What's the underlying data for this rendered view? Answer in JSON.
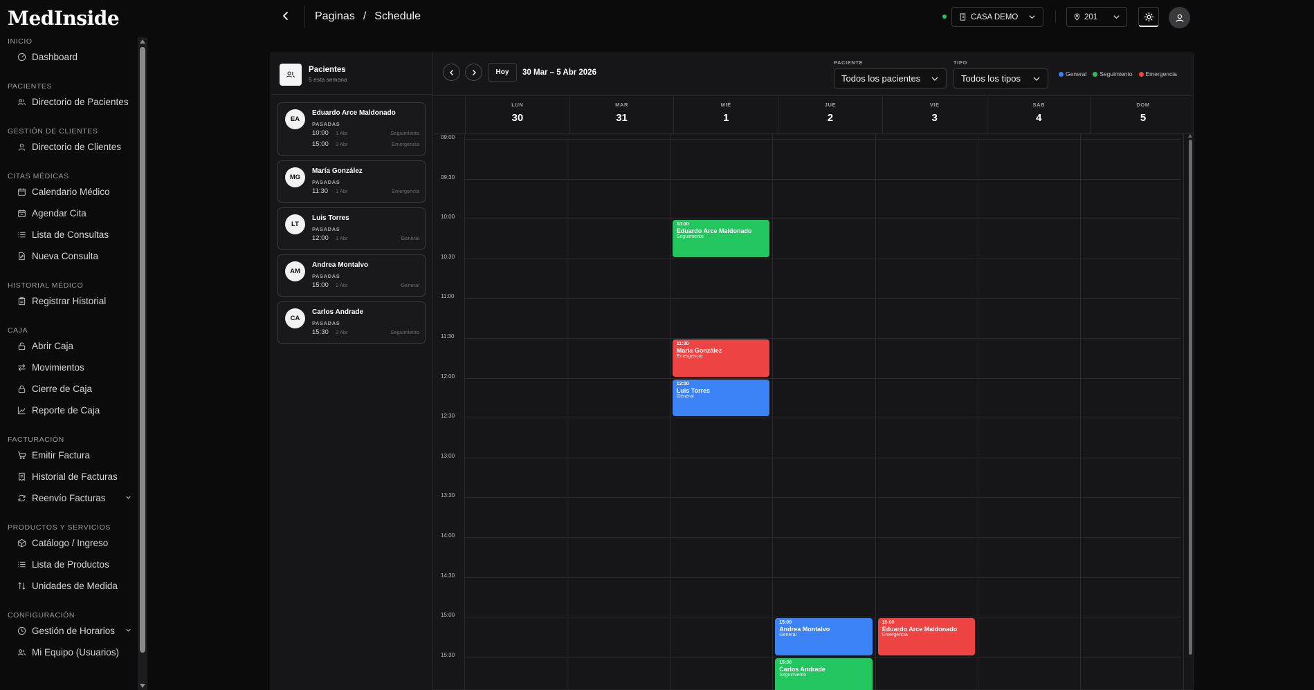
{
  "app": {
    "logo": "MedInside"
  },
  "sidebar": {
    "sections": [
      {
        "title": "INICIO",
        "items": [
          {
            "label": "Dashboard",
            "icon": "dashboard-icon"
          }
        ]
      },
      {
        "title": "PACIENTES",
        "items": [
          {
            "label": "Directorio de Pacientes",
            "icon": "users-icon"
          }
        ]
      },
      {
        "title": "GESTIÓN DE CLIENTES",
        "items": [
          {
            "label": "Directorio de Clientes",
            "icon": "user-icon"
          }
        ]
      },
      {
        "title": "CITAS MÉDICAS",
        "items": [
          {
            "label": "Calendario Médico",
            "icon": "calendar-icon"
          },
          {
            "label": "Agendar Cita",
            "icon": "calendar-plus-icon"
          },
          {
            "label": "Lista de Consultas",
            "icon": "list-icon"
          },
          {
            "label": "Nueva Consulta",
            "icon": "file-plus-icon"
          }
        ]
      },
      {
        "title": "HISTORIAL MÉDICO",
        "items": [
          {
            "label": "Registrar Historial",
            "icon": "clipboard-icon"
          }
        ]
      },
      {
        "title": "CAJA",
        "items": [
          {
            "label": "Abrir Caja",
            "icon": "unlock-icon"
          },
          {
            "label": "Movimientos",
            "icon": "arrows-icon"
          },
          {
            "label": "Cierre de Caja",
            "icon": "lock-icon"
          },
          {
            "label": "Reporte de Caja",
            "icon": "chart-line-icon"
          }
        ]
      },
      {
        "title": "FACTURACIÓN",
        "items": [
          {
            "label": "Emitir Factura",
            "icon": "cart-icon"
          },
          {
            "label": "Historial de Facturas",
            "icon": "receipt-icon"
          },
          {
            "label": "Reenvío Facturas",
            "icon": "refresh-icon",
            "expandable": true
          }
        ]
      },
      {
        "title": "PRODUCTOS Y SERVICIOS",
        "items": [
          {
            "label": "Catálogo / Ingreso",
            "icon": "box-icon"
          },
          {
            "label": "Lista de Productos",
            "icon": "list-icon"
          },
          {
            "label": "Unidades de Medida",
            "icon": "sort-icon"
          }
        ]
      },
      {
        "title": "CONFIGURACIÓN",
        "items": [
          {
            "label": "Gestión de Horarios",
            "icon": "clock-icon",
            "expandable": true
          },
          {
            "label": "Mi Equipo (Usuarios)",
            "icon": "users-icon"
          }
        ]
      }
    ]
  },
  "header": {
    "breadcrumb": [
      "Paginas",
      "/",
      "Schedule"
    ],
    "company": "CASA DEMO",
    "location": "201"
  },
  "patients_panel": {
    "title": "Pacientes",
    "subtitle": "5 esta semana",
    "patients": [
      {
        "initials": "EA",
        "name": "Eduardo Arce Maldonado",
        "status": "PASADAS",
        "appointments": [
          {
            "time": "10:00",
            "date": "1 Abr",
            "type": "Seguimiento"
          },
          {
            "time": "15:00",
            "date": "3 Abr",
            "type": "Emergencia"
          }
        ]
      },
      {
        "initials": "MG",
        "name": "María González",
        "status": "PASADAS",
        "appointments": [
          {
            "time": "11:30",
            "date": "1 Abr",
            "type": "Emergencia"
          }
        ]
      },
      {
        "initials": "LT",
        "name": "Luis Torres",
        "status": "PASADAS",
        "appointments": [
          {
            "time": "12:00",
            "date": "1 Abr",
            "type": "General"
          }
        ]
      },
      {
        "initials": "AM",
        "name": "Andrea Montalvo",
        "status": "PASADAS",
        "appointments": [
          {
            "time": "15:00",
            "date": "2 Abr",
            "type": "General"
          }
        ]
      },
      {
        "initials": "CA",
        "name": "Carlos Andrade",
        "status": "PASADAS",
        "appointments": [
          {
            "time": "15:30",
            "date": "2 Abr",
            "type": "Seguimiento"
          }
        ]
      }
    ]
  },
  "calendar": {
    "today_label": "Hoy",
    "range": "30 Mar – 5 Abr 2026",
    "filters": {
      "patient_label": "PACIENTE",
      "patient_value": "Todos los pacientes",
      "type_label": "TIPO",
      "type_value": "Todos los tipos"
    },
    "legend": [
      {
        "label": "General",
        "color": "#3b82f6"
      },
      {
        "label": "Seguimiento",
        "color": "#22c55e"
      },
      {
        "label": "Emergencia",
        "color": "#ef4444"
      }
    ],
    "days": [
      {
        "name": "LUN",
        "num": "30"
      },
      {
        "name": "MAR",
        "num": "31"
      },
      {
        "name": "MIÉ",
        "num": "1"
      },
      {
        "name": "JUE",
        "num": "2"
      },
      {
        "name": "VIE",
        "num": "3"
      },
      {
        "name": "SÁB",
        "num": "4"
      },
      {
        "name": "DOM",
        "num": "5"
      }
    ],
    "time_slots": [
      "09:00",
      "09:30",
      "10:00",
      "10:30",
      "11:00",
      "11:30",
      "12:00",
      "12:30",
      "13:00",
      "13:30",
      "14:00",
      "14:30",
      "15:00",
      "15:30"
    ],
    "events": [
      {
        "day": 2,
        "time": "10:00",
        "name": "Eduardo Arce Maldonado",
        "type": "Seguimiento",
        "color": "#22c55e"
      },
      {
        "day": 2,
        "time": "11:30",
        "name": "María González",
        "type": "Emergencia",
        "color": "#ef4444"
      },
      {
        "day": 2,
        "time": "12:00",
        "name": "Luis Torres",
        "type": "General",
        "color": "#3b82f6"
      },
      {
        "day": 3,
        "time": "15:00",
        "name": "Andrea Montalvo",
        "type": "General",
        "color": "#3b82f6"
      },
      {
        "day": 4,
        "time": "15:00",
        "name": "Eduardo Arce Maldonado",
        "type": "Emergencia",
        "color": "#ef4444"
      },
      {
        "day": 3,
        "time": "15:30",
        "name": "Carlos Andrade",
        "type": "Seguimiento",
        "color": "#22c55e"
      }
    ]
  }
}
